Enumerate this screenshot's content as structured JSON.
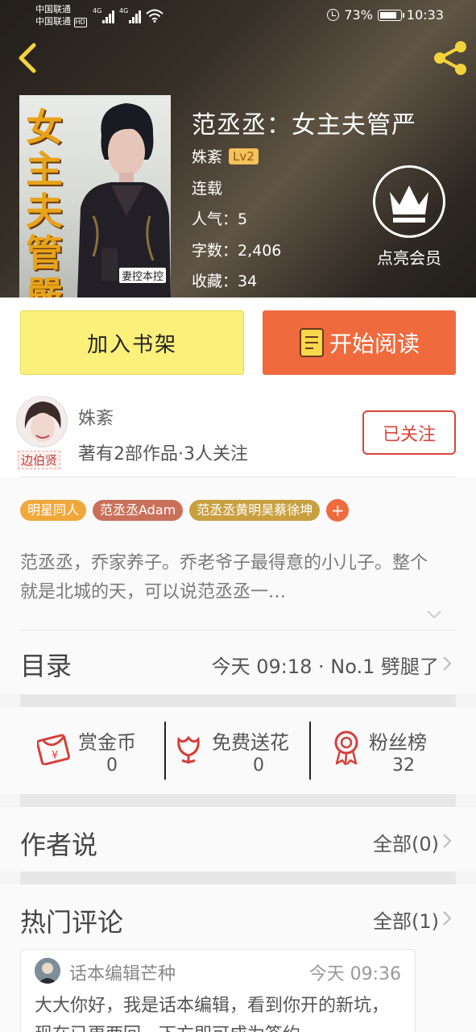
{
  "status_bar": {
    "carrier_1": "中国联通",
    "carrier_2": "中国联通",
    "hd": "HD",
    "network_1": "4G",
    "network_2": "4G",
    "battery": "73%",
    "time": "10:33"
  },
  "book": {
    "cover_text": "女主夫管嚴",
    "cover_badge": "妻控本控",
    "title": "范丞丞：女主夫管严",
    "author": "姝紊",
    "author_level": "Lv2",
    "status": "连载",
    "popularity": "人气：5",
    "word_count": "字数：2,406",
    "favorites": "收藏：34",
    "vip_label": "点亮会员"
  },
  "actions": {
    "add_shelf": "加入书架",
    "start_read": "开始阅读"
  },
  "author_card": {
    "name": "姝紊",
    "avatar_tag": "边伯贤",
    "works": "著有2部作品·3人关注",
    "follow_label": "已关注"
  },
  "tags": [
    {
      "label": "明星同人",
      "color": "#f0a83a"
    },
    {
      "label": "范丞丞Adam",
      "color": "#c9705a"
    },
    {
      "label": "范丞丞黄明昊蔡徐坤",
      "color": "#c9a040"
    }
  ],
  "tag_plus": "+",
  "description": "范丞丞，乔家养子。乔老爷子最得意的小儿子。整个就是北城的天，可以说范丞丞一…",
  "catalog": {
    "title": "目录",
    "latest": "今天 09:18 · No.1 劈腿了"
  },
  "rewards": [
    {
      "label": "赏金币",
      "value": "0",
      "icon": "red-envelope-icon"
    },
    {
      "label": "免费送花",
      "value": "0",
      "icon": "flower-icon"
    },
    {
      "label": "粉丝榜",
      "value": "32",
      "icon": "award-ribbon-icon"
    }
  ],
  "author_says": {
    "title": "作者说",
    "link": "全部(0)"
  },
  "hot_comments": {
    "title": "热门评论",
    "link": "全部(1)",
    "first": {
      "name": "话本编辑芒种",
      "time": "今天 09:36",
      "text": "大大你好，我是话本编辑，看到你开的新坑，现在已更两回，下方即可成为签约..."
    }
  },
  "colors": {
    "accent_orange": "#ef6a3d",
    "shelf_yellow": "#fbf07a",
    "follow_red": "#d9453b"
  }
}
